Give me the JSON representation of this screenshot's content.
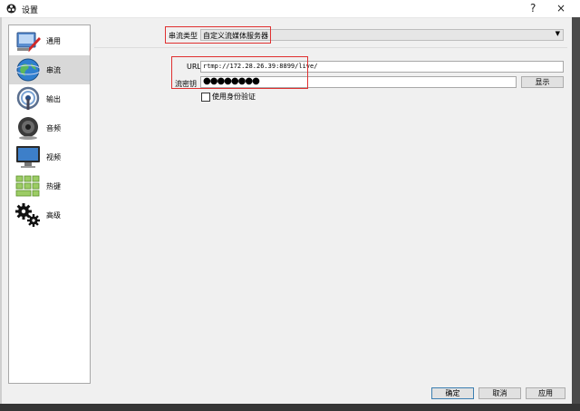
{
  "window": {
    "title": "设置",
    "help_label": "?",
    "close_label": "×"
  },
  "sidebar": {
    "items": [
      {
        "label": "通用",
        "icon": "general-settings-icon"
      },
      {
        "label": "串流",
        "icon": "globe-stream-icon"
      },
      {
        "label": "输出",
        "icon": "output-antenna-icon"
      },
      {
        "label": "音频",
        "icon": "speaker-icon"
      },
      {
        "label": "视频",
        "icon": "monitor-icon"
      },
      {
        "label": "热键",
        "icon": "keyboard-icon"
      },
      {
        "label": "高级",
        "icon": "gears-icon"
      }
    ],
    "active_index": 1
  },
  "stream": {
    "type_label": "串流类型",
    "type_value": "自定义流媒体服务器",
    "url_label": "URL",
    "url_value": "rtmp://172.28.26.39:8899/live/",
    "key_label": "流密钥",
    "key_value": "●●●●●●●●",
    "show_button": "显示",
    "auth_checkbox_label": "使用身份验证",
    "auth_checked": false
  },
  "footer": {
    "ok": "确定",
    "cancel": "取消",
    "apply": "应用"
  },
  "colors": {
    "highlight_box": "#e03030",
    "active_item": "#d8d8d8",
    "primary_border": "#3c7fb1"
  }
}
